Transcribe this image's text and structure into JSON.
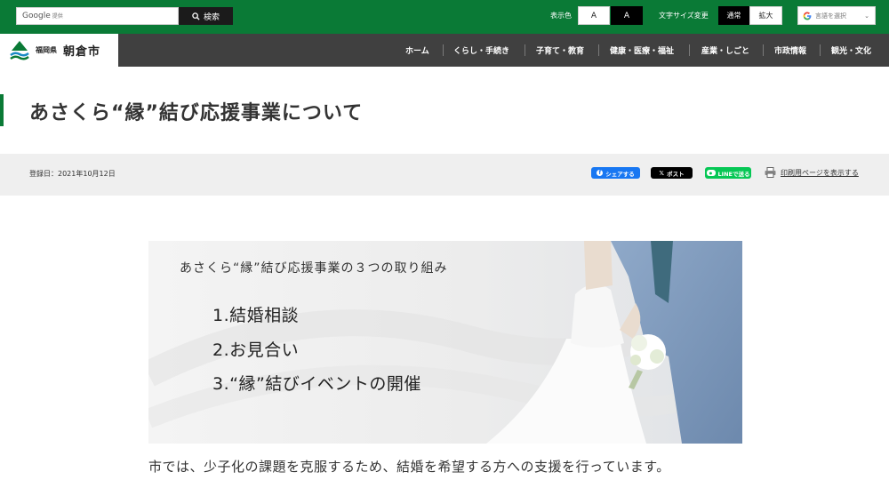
{
  "header": {
    "search": {
      "brand": "Google",
      "brand_sub": "提供",
      "placeholder": "",
      "button_label": "検索"
    },
    "display_color": {
      "label": "表示色",
      "white_option": "A",
      "black_option": "A"
    },
    "font_size": {
      "label": "文字サイズ変更",
      "normal": "通常",
      "large": "拡大"
    },
    "language": {
      "selected": "言語を選択"
    }
  },
  "logo": {
    "prefecture": "福岡県",
    "city": "朝倉市"
  },
  "nav": {
    "items": [
      {
        "label": "ホーム"
      },
      {
        "label": "くらし・手続き"
      },
      {
        "label": "子育て・教育"
      },
      {
        "label": "健康・医療・福祉"
      },
      {
        "label": "産業・しごと"
      },
      {
        "label": "市政情報"
      },
      {
        "label": "観光・文化"
      }
    ]
  },
  "page": {
    "title": "あさくら“縁”結び応援事業について",
    "registered_date": "登録日：2021年10月12日"
  },
  "share": {
    "facebook": "シェアする",
    "x": "ポスト",
    "line": "LINEで送る",
    "print": "印刷用ページを表示する"
  },
  "banner": {
    "heading": "あさくら“縁”結び応援事業の３つの取り組み",
    "items": [
      "1.結婚相談",
      "2.お見合い",
      "3.“縁”結びイベントの開催"
    ]
  },
  "content": {
    "intro": "市では、少子化の課題を克服するため、結婚を希望する方への支援を行っています。"
  },
  "colors": {
    "brand_green": "#0a7a36",
    "nav_background": "#404040",
    "meta_background": "#efefef",
    "facebook_blue": "#1877f2",
    "line_green": "#06c755"
  }
}
